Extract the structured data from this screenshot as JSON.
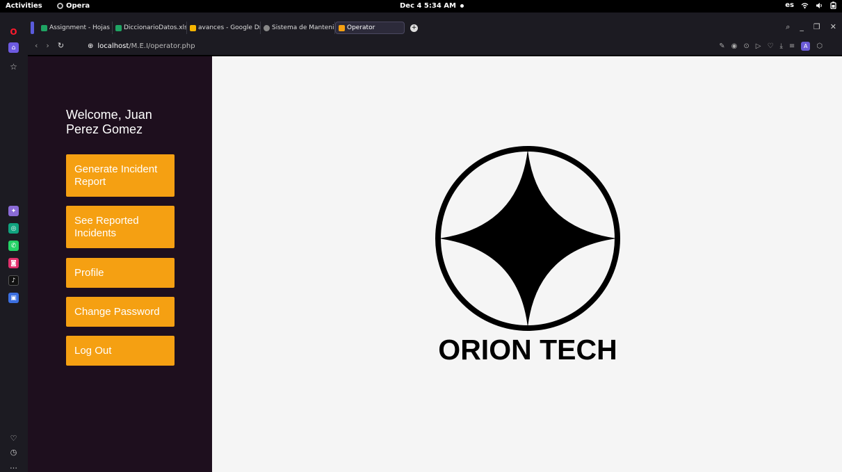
{
  "topbar": {
    "activities": "Activities",
    "app_name": "Opera",
    "clock": "Dec 4  5:34 AM",
    "lang": "es"
  },
  "tabs": [
    {
      "label": "Assignment - Hojas",
      "color": "#1fa463"
    },
    {
      "label": "DiccionarioDatos.xls",
      "color": "#1fa463"
    },
    {
      "label": "avances - Google Dr",
      "color": "#f4b400"
    },
    {
      "label": "Sistema de Mantenir",
      "color": "#888888"
    },
    {
      "label": "Operator",
      "color": "#f5a012"
    }
  ],
  "address": {
    "host": "localhost",
    "path": "/M.E.I/operator.php"
  },
  "sidebar": {
    "welcome": "Welcome, Juan Perez Gomez",
    "buttons": [
      {
        "label": "Generate Incident Report"
      },
      {
        "label": "See Reported Incidents"
      },
      {
        "label": "Profile"
      },
      {
        "label": "Change Password"
      },
      {
        "label": "Log Out"
      }
    ]
  },
  "logo": {
    "text": "ORION TECH"
  },
  "colors": {
    "sidebar_bg": "#1e0f1e",
    "button_bg": "#f5a012",
    "content_bg": "#f5f5f5"
  }
}
